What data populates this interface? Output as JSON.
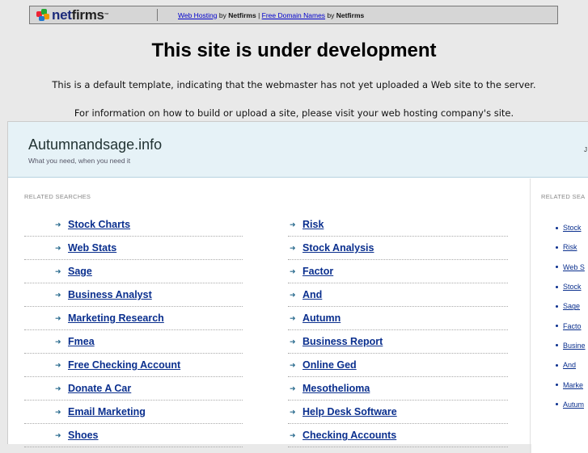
{
  "topbar": {
    "logo_text_n": "net",
    "logo_text_f": "firms",
    "logo_tm": "™",
    "link1": "Web Hosting",
    "by1": " by ",
    "brand1": "Netfirms",
    "pipe": " | ",
    "link2": "Free Domain Names",
    "by2": " by ",
    "brand2": "Netfirms"
  },
  "notice": {
    "headline": "This site is under development",
    "line1": "This is a default template, indicating that the webmaster has not yet uploaded a Web site to the server.",
    "line2": "For information on how to build or upload a site, please visit your web hosting company's site."
  },
  "site": {
    "title": "Autumnandsage.info",
    "tagline": "What you need, when you need it",
    "right_letter": "J"
  },
  "main": {
    "related_label": "RELATED SEARCHES",
    "left_items": [
      "Stock Charts",
      "Web Stats",
      "Sage",
      "Business Analyst",
      "Marketing Research",
      "Fmea",
      "Free Checking Account",
      "Donate A Car",
      "Email Marketing",
      "Shoes"
    ],
    "right_items": [
      "Risk",
      "Stock Analysis",
      "Factor",
      "And",
      "Autumn",
      "Business Report",
      "Online Ged",
      "Mesothelioma",
      "Help Desk Software",
      "Checking Accounts"
    ]
  },
  "side": {
    "related_label": "RELATED SEA",
    "items": [
      "Stock",
      "Risk",
      "Web S",
      "Stock",
      "Sage",
      "Facto",
      "Busine",
      "And",
      "Marke",
      "Autum"
    ]
  },
  "colors": {
    "background": "#e9e9e9",
    "link": "#0a2f8e",
    "header_bg": "#e6f2f7"
  }
}
